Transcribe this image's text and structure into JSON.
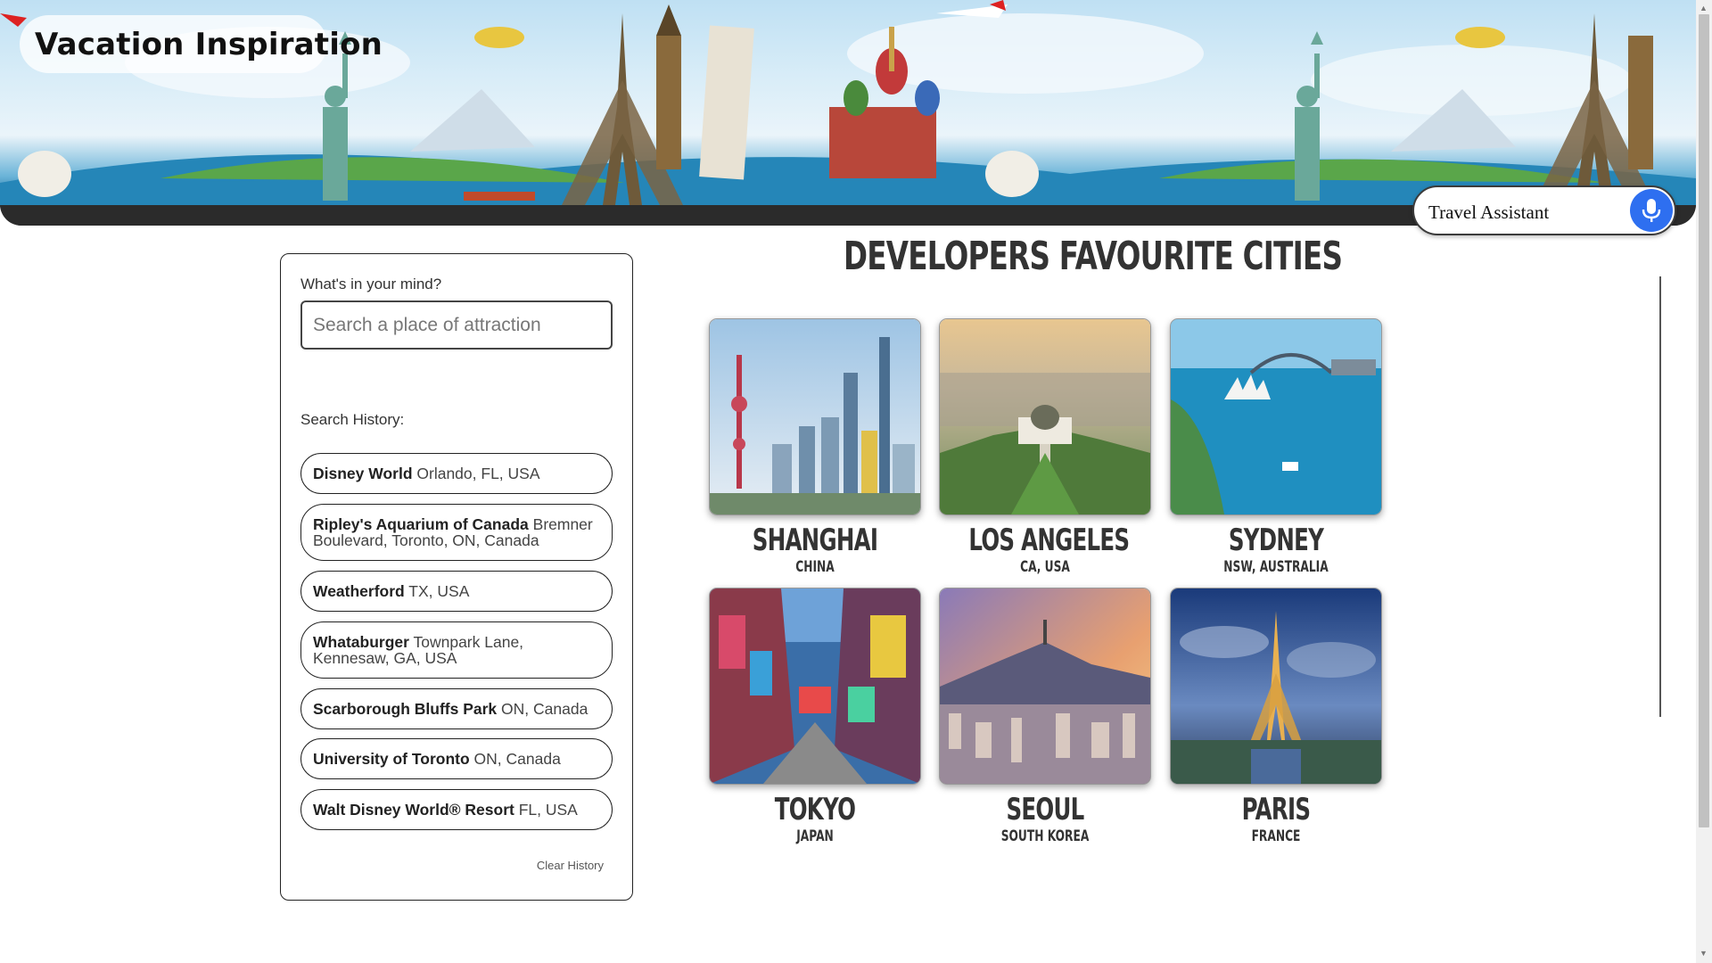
{
  "header": {
    "title": "Vacation Inspiration",
    "assistant_label": "Travel Assistant"
  },
  "search": {
    "label": "What's in your mind?",
    "placeholder": "Search a place of attraction",
    "value": ""
  },
  "history": {
    "label": "Search History:",
    "items": [
      {
        "name": "Disney World",
        "detail": "Orlando, FL, USA"
      },
      {
        "name": "Ripley's Aquarium of Canada",
        "detail": "Bremner Boulevard, Toronto, ON, Canada"
      },
      {
        "name": "Weatherford",
        "detail": "TX, USA"
      },
      {
        "name": "Whataburger",
        "detail": "Townpark Lane, Kennesaw, GA, USA"
      },
      {
        "name": "Scarborough Bluffs Park",
        "detail": "ON, Canada"
      },
      {
        "name": "University of Toronto",
        "detail": "ON, Canada"
      },
      {
        "name": "Walt Disney World® Resort",
        "detail": "FL, USA"
      }
    ],
    "clear_label": "Clear History"
  },
  "main": {
    "title": "DEVELOPERS FAVOURITE CITIES",
    "cities": [
      {
        "name": "SHANGHAI",
        "country": "CHINA"
      },
      {
        "name": "LOS ANGELES",
        "country": "CA, USA"
      },
      {
        "name": "SYDNEY",
        "country": "NSW, AUSTRALIA"
      },
      {
        "name": "TOKYO",
        "country": "JAPAN"
      },
      {
        "name": "SEOUL",
        "country": "SOUTH KOREA"
      },
      {
        "name": "PARIS",
        "country": "FRANCE"
      }
    ]
  },
  "colors": {
    "accent": "#2e6ff0",
    "text": "#333333",
    "banner_footer": "#2b2b2b"
  },
  "icons": {
    "mic": "microphone-icon"
  }
}
